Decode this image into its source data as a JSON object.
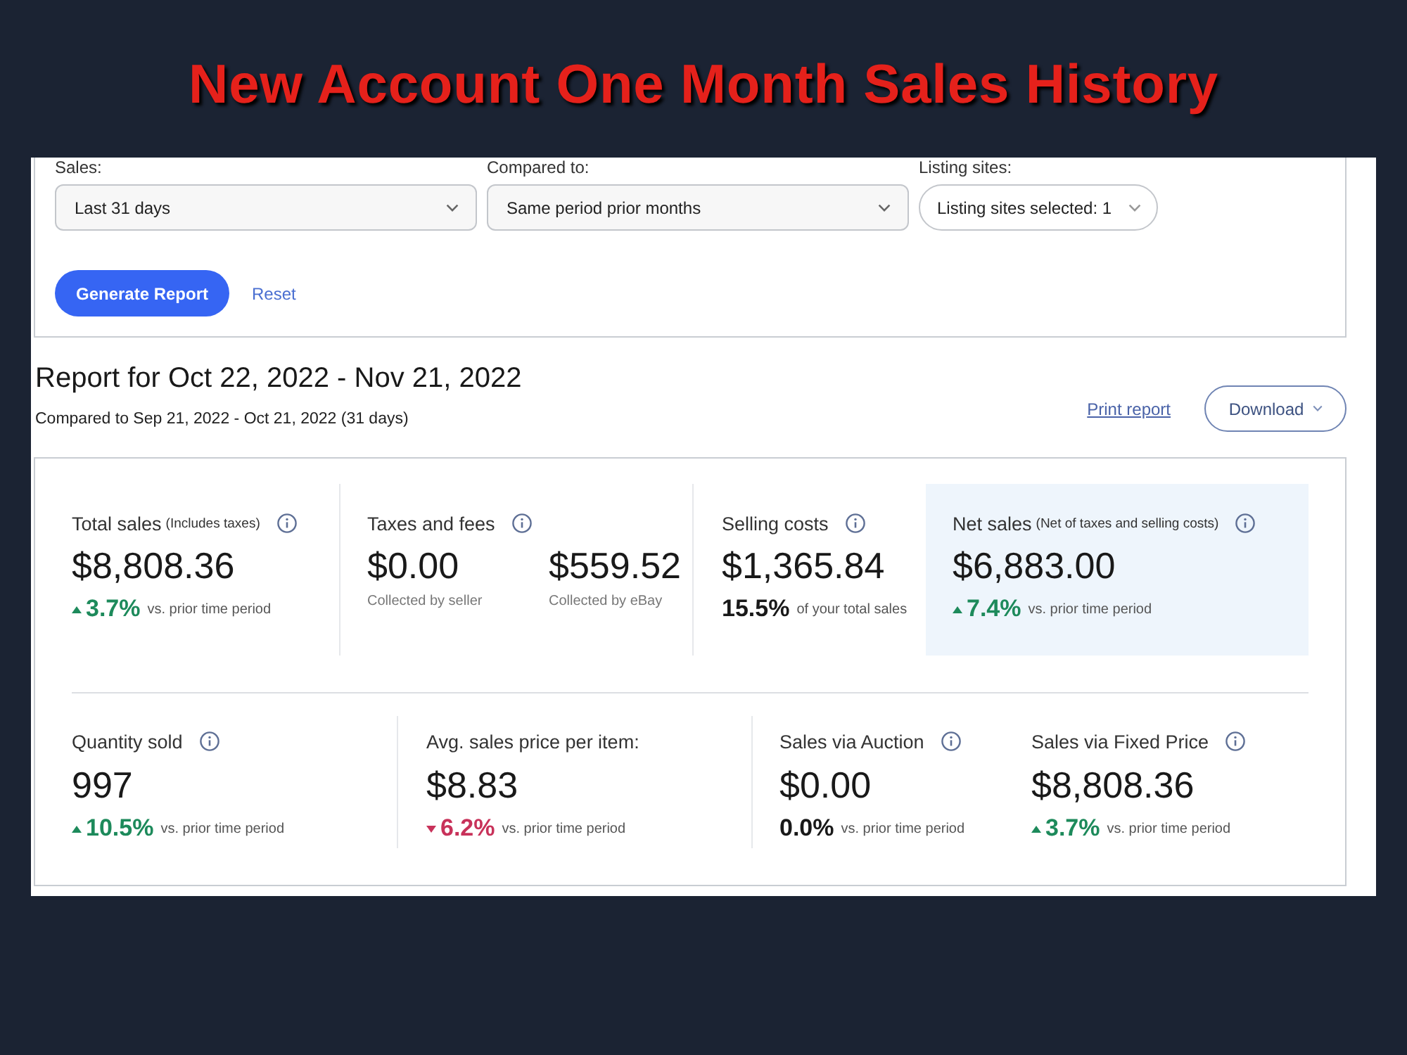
{
  "headline": "New Account One Month Sales History",
  "filters": [
    {
      "label": "Sales:",
      "value": "Last 31 days",
      "kind": "select"
    },
    {
      "label": "Compared to:",
      "value": "Same period prior months",
      "kind": "select"
    },
    {
      "label": "Listing sites:",
      "value": "Listing sites selected: 1",
      "kind": "pill"
    }
  ],
  "actions": [
    {
      "label": "Generate Report",
      "kind": "primary"
    },
    {
      "label": "Reset",
      "kind": "link"
    }
  ],
  "report": {
    "heading": "Report for Oct 22, 2022 - Nov 21, 2022",
    "comparison": "Compared to Sep 21, 2022 - Oct 21, 2022 (31 days)",
    "tools": [
      {
        "label": "Print report",
        "kind": "link"
      },
      {
        "label": "Download",
        "kind": "menu"
      }
    ]
  },
  "metrics_card": {
    "rows": [
      {
        "metrics": [
          {
            "label": "Total sales",
            "qualifier": "(Includes taxes)",
            "info": true,
            "highlighted": false,
            "values": [
              {
                "amount": "$8,808.36"
              }
            ],
            "change": {
              "kind": "increase",
              "value": "3.7%",
              "note": "vs. prior time period"
            }
          },
          {
            "label": "Taxes and fees",
            "info": true,
            "highlighted": false,
            "values": [
              {
                "amount": "$0.00",
                "caption": "Collected by seller"
              },
              {
                "amount": "$559.52",
                "caption": "Collected by eBay"
              }
            ]
          },
          {
            "label": "Selling costs",
            "info": true,
            "highlighted": false,
            "values": [
              {
                "amount": "$1,365.84"
              }
            ],
            "change": {
              "kind": "neutral",
              "value": "15.5%",
              "note": "of your total sales"
            }
          },
          {
            "label": "Net sales",
            "qualifier": "(Net of taxes and selling costs)",
            "info": true,
            "highlighted": true,
            "values": [
              {
                "amount": "$6,883.00"
              }
            ],
            "change": {
              "kind": "increase",
              "value": "7.4%",
              "note": "vs. prior time period"
            }
          }
        ]
      },
      {
        "metrics": [
          {
            "label": "Quantity sold",
            "info": true,
            "highlighted": false,
            "values": [
              {
                "amount": "997"
              }
            ],
            "change": {
              "kind": "increase",
              "value": "10.5%",
              "note": "vs. prior time period"
            }
          },
          {
            "label": "Avg. sales price per item:",
            "info": false,
            "highlighted": false,
            "values": [
              {
                "amount": "$8.83"
              }
            ],
            "change": {
              "kind": "decrease",
              "value": "6.2%",
              "note": "vs. prior time period"
            }
          },
          {
            "label": "Sales via Auction",
            "info": true,
            "highlighted": false,
            "values": [
              {
                "amount": "$0.00"
              }
            ],
            "change": {
              "kind": "neutral",
              "value": "0.0%",
              "note": "vs. prior time period"
            }
          },
          {
            "label": "Sales via Fixed Price",
            "info": true,
            "highlighted": false,
            "values": [
              {
                "amount": "$8,808.36"
              }
            ],
            "change": {
              "kind": "increase",
              "value": "3.7%",
              "note": "vs. prior time period"
            }
          }
        ]
      }
    ]
  }
}
